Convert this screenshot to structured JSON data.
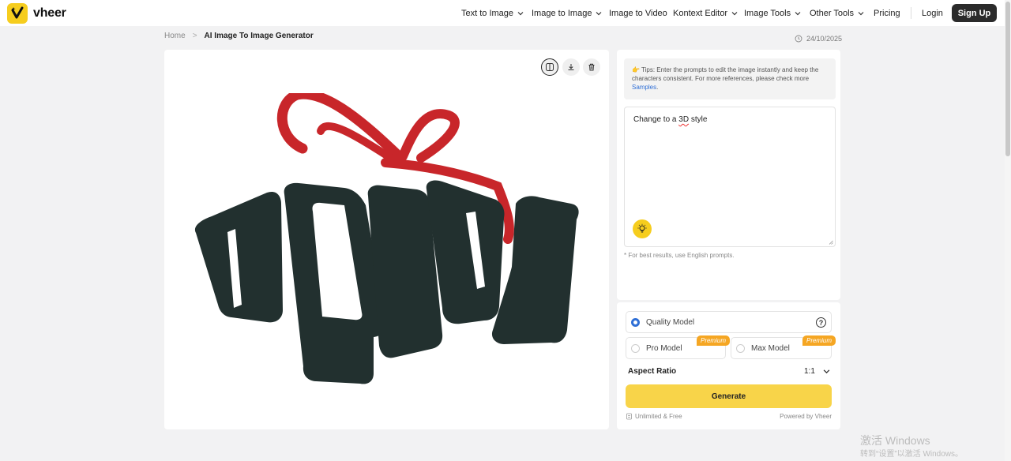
{
  "brand": {
    "name": "vheer",
    "accent": "#f6cd1e"
  },
  "nav": {
    "items": [
      {
        "label": "Text to Image",
        "dropdown": true
      },
      {
        "label": "Image to Image",
        "dropdown": true
      },
      {
        "label": "Image to Video",
        "dropdown": false
      },
      {
        "label": "Kontext Editor",
        "dropdown": true
      },
      {
        "label": "Image Tools",
        "dropdown": true
      },
      {
        "label": "Other Tools",
        "dropdown": true
      },
      {
        "label": "Pricing",
        "dropdown": false
      }
    ],
    "login": "Login",
    "signup": "Sign Up"
  },
  "breadcrumb": {
    "home": "Home",
    "sep": ">",
    "current": "AI Image To Image Generator"
  },
  "date": "24/10/2025",
  "image_toolbar": [
    "compare-icon",
    "download-icon",
    "trash-icon"
  ],
  "tips": {
    "prefix": "Tips: Enter the prompts to edit the image instantly and keep the characters consistent. For more references, please check more ",
    "link": "Samples",
    "suffix": "."
  },
  "prompt": {
    "before": "Change to a ",
    "misspelled": "3D",
    "after": " style"
  },
  "note": "* For best results, use English prompts.",
  "models": {
    "quality": "Quality Model",
    "pro": "Pro Model",
    "max": "Max Model",
    "badge": "Premium",
    "help": "?"
  },
  "aspect": {
    "label": "Aspect Ratio",
    "value": "1:1"
  },
  "generate": "Generate",
  "footer": {
    "left": "Unlimited & Free",
    "right": "Powered by Vheer"
  },
  "watermark": {
    "line1": "激活 Windows",
    "line2": "转到“设置”以激活 Windows。"
  }
}
